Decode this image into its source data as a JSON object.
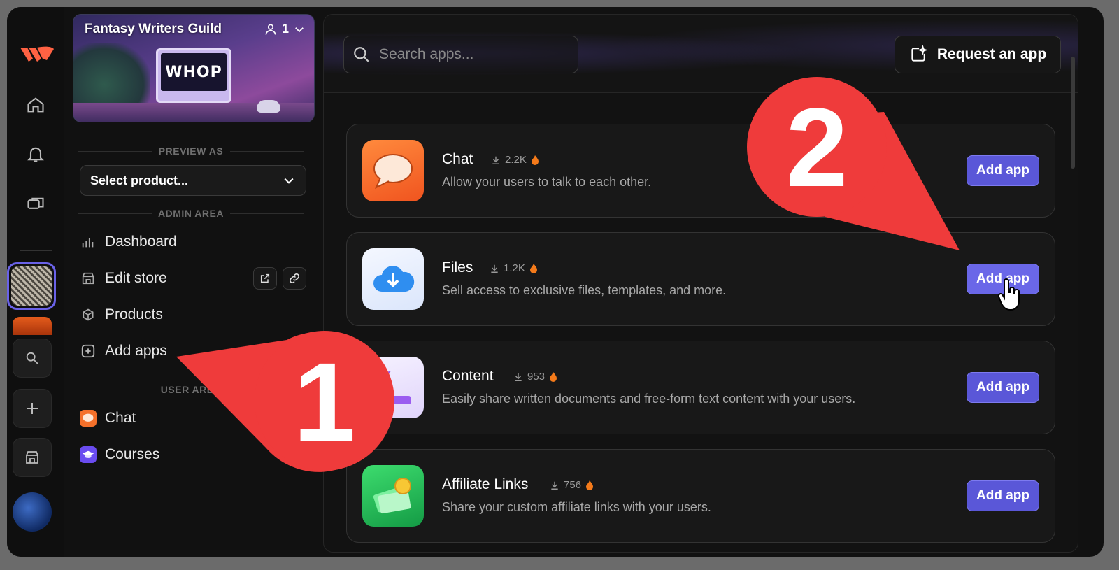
{
  "sidebar_header": {
    "community_name": "Fantasy Writers Guild",
    "member_count": "1",
    "banner_screen_text": "WHOP"
  },
  "preview": {
    "label": "PREVIEW AS",
    "select_value": "Select product..."
  },
  "admin": {
    "label": "ADMIN AREA",
    "items": [
      {
        "label": "Dashboard",
        "icon": "bar-chart-icon"
      },
      {
        "label": "Edit store",
        "icon": "store-icon"
      },
      {
        "label": "Products",
        "icon": "cube-icon"
      },
      {
        "label": "Add apps",
        "icon": "plus-square-icon"
      }
    ]
  },
  "user_area": {
    "label": "USER AREA",
    "items": [
      {
        "label": "Chat",
        "icon": "chat-bubble-icon"
      },
      {
        "label": "Courses",
        "icon": "graduation-cap-icon"
      }
    ]
  },
  "toolbar": {
    "search_placeholder": "Search apps...",
    "request_label": "Request an app"
  },
  "apps": [
    {
      "name": "Chat",
      "downloads": "2.2K",
      "description": "Allow your users to talk to each other.",
      "button": "Add app",
      "color": "#f4702a"
    },
    {
      "name": "Files",
      "downloads": "1.2K",
      "description": "Sell access to exclusive files, templates, and more.",
      "button": "Add app",
      "color": "#4aa3f0"
    },
    {
      "name": "Content",
      "downloads": "953",
      "description": "Easily share written documents and free-form text content with your users.",
      "button": "Add app",
      "color": "#9b5cf0"
    },
    {
      "name": "Affiliate Links",
      "downloads": "756",
      "description": "Share your custom affiliate links with your users.",
      "button": "Add app",
      "color": "#2fbf5a"
    }
  ],
  "annotations": {
    "step1": "1",
    "step2": "2",
    "color": "#ef3b3b"
  },
  "colors": {
    "accent": "#5a57d8",
    "background": "#111111"
  }
}
